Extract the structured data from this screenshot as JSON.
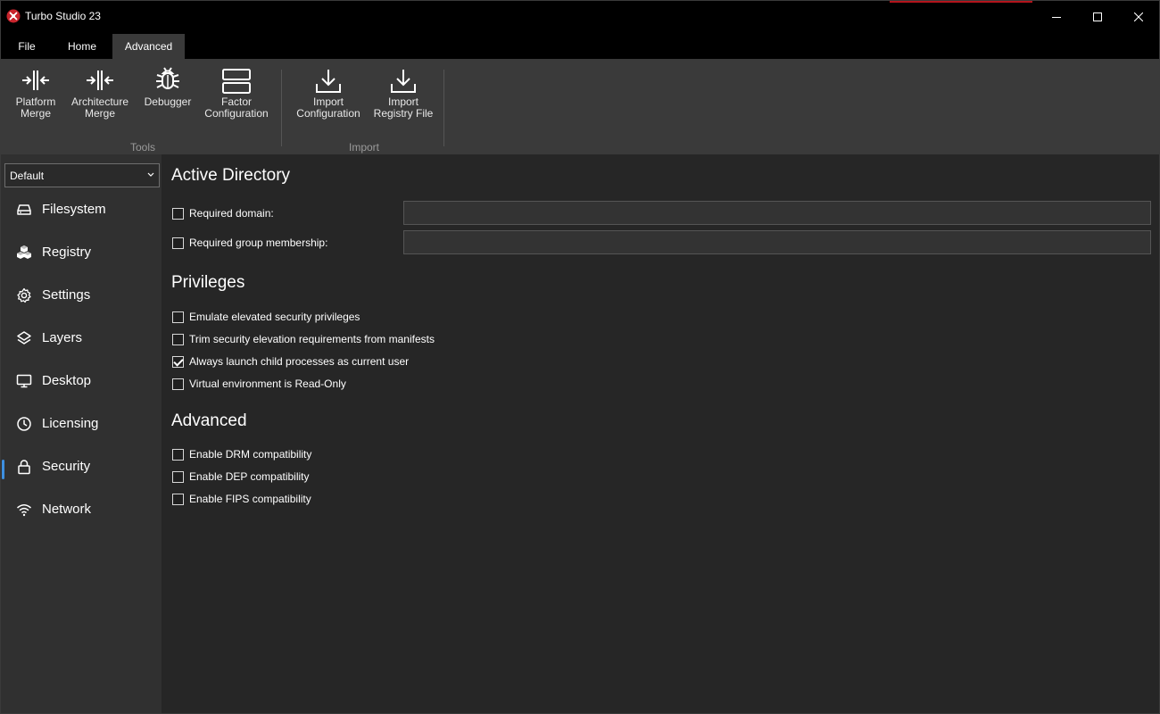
{
  "window": {
    "title": "Turbo Studio 23"
  },
  "menu": {
    "tabs": [
      {
        "label": "File"
      },
      {
        "label": "Home"
      },
      {
        "label": "Advanced"
      }
    ]
  },
  "ribbon": {
    "tools": {
      "label": "Tools",
      "buttons": [
        {
          "label": "Platform\nMerge",
          "icon": "merge-icon"
        },
        {
          "label": "Architecture\nMerge",
          "icon": "merge-icon"
        },
        {
          "label": "Debugger",
          "icon": "bug-icon"
        },
        {
          "label": "Factor\nConfiguration",
          "icon": "layout-icon"
        }
      ]
    },
    "import": {
      "label": "Import",
      "buttons": [
        {
          "label": "Import\nConfiguration",
          "icon": "download-icon"
        },
        {
          "label": "Import\nRegistry File",
          "icon": "download-icon"
        }
      ]
    }
  },
  "sidebar": {
    "profile": "Default",
    "items": [
      {
        "label": "Filesystem",
        "icon": "drive-icon"
      },
      {
        "label": "Registry",
        "icon": "registry-icon"
      },
      {
        "label": "Settings",
        "icon": "gear-icon"
      },
      {
        "label": "Layers",
        "icon": "layers-icon"
      },
      {
        "label": "Desktop",
        "icon": "monitor-icon"
      },
      {
        "label": "Licensing",
        "icon": "clock-icon"
      },
      {
        "label": "Security",
        "icon": "lock-icon",
        "active": true
      },
      {
        "label": "Network",
        "icon": "wifi-icon"
      }
    ]
  },
  "content": {
    "active_directory": {
      "title": "Active Directory",
      "required_domain": {
        "label": "Required domain:",
        "checked": false,
        "value": ""
      },
      "required_group": {
        "label": "Required group membership:",
        "checked": false,
        "value": ""
      }
    },
    "privileges": {
      "title": "Privileges",
      "options": [
        {
          "label": "Emulate elevated security privileges",
          "checked": false
        },
        {
          "label": "Trim security elevation requirements from manifests",
          "checked": false
        },
        {
          "label": "Always launch child processes as current user",
          "checked": true
        },
        {
          "label": "Virtual environment is Read-Only",
          "checked": false
        }
      ]
    },
    "advanced": {
      "title": "Advanced",
      "options": [
        {
          "label": "Enable DRM compatibility",
          "checked": false
        },
        {
          "label": "Enable DEP compatibility",
          "checked": false
        },
        {
          "label": "Enable FIPS compatibility",
          "checked": false
        }
      ]
    }
  },
  "colors": {
    "accent": "#3d8fe0",
    "background": "#262626",
    "sidebar": "#303030",
    "ribbon": "#3a3a3a",
    "titlebar": "#000000"
  }
}
